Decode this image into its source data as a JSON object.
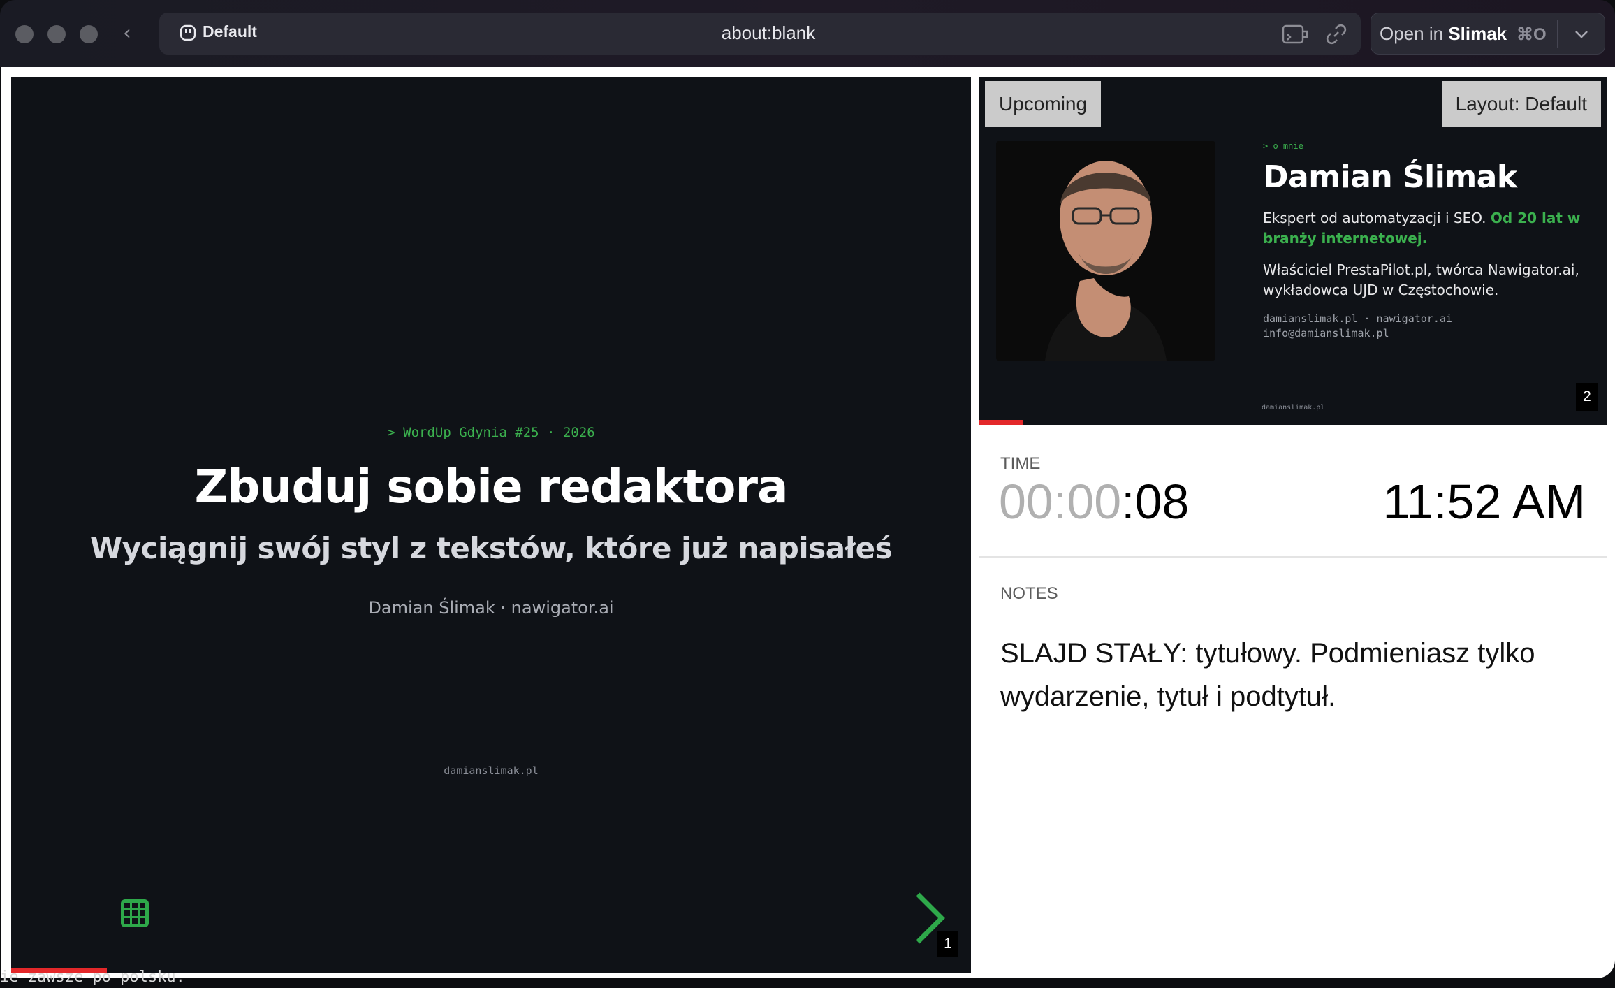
{
  "browser": {
    "profile_label": "Default",
    "url": "about:blank",
    "open_in_prefix": "Open in",
    "open_in_app": "Slimak",
    "open_in_shortcut": "⌘O"
  },
  "current_slide": {
    "event": "> WordUp Gdynia #25 · 2026",
    "title": "Zbuduj sobie redaktora",
    "subtitle": "Wyciągnij swój styl z tekstów, które już napisałeś",
    "author": "Damian Ślimak · nawigator.ai",
    "footer": "damianslimak.pl",
    "slide_number": "1",
    "progress": 0.1
  },
  "upcoming_slide": {
    "tag": "Upcoming",
    "layout_button": "Layout: Default",
    "kicker": "> o mnie",
    "name": "Damian Ślimak",
    "bio_plain": "Ekspert od automatyzacji i SEO. ",
    "bio_highlight": "Od 20 lat w branży internetowej.",
    "bio_second": "Właściciel PrestaPilot.pl, twórca Nawigator.ai, wykładowca UJD w Częstochowie.",
    "contact_line1": "damianslimak.pl · nawigator.ai",
    "contact_line2": "info@damianslimak.pl",
    "footer": "damianslimak.pl",
    "slide_number": "2",
    "progress": 0.07
  },
  "time": {
    "label": "TIME",
    "elapsed_dim": "00:00",
    "elapsed_active": ":08",
    "clock": "11:52 AM"
  },
  "notes": {
    "label": "NOTES",
    "text": "SLAJD STAŁY: tytułowy. Podmieniasz tylko wydarzenie, tytuł i podtytuł."
  },
  "terminal": {
    "visible_text": "ie zawsze po polsku."
  },
  "colors": {
    "accent_green": "#3bb04e",
    "progress_red": "#e3282a",
    "slide_bg": "#0f1217"
  }
}
